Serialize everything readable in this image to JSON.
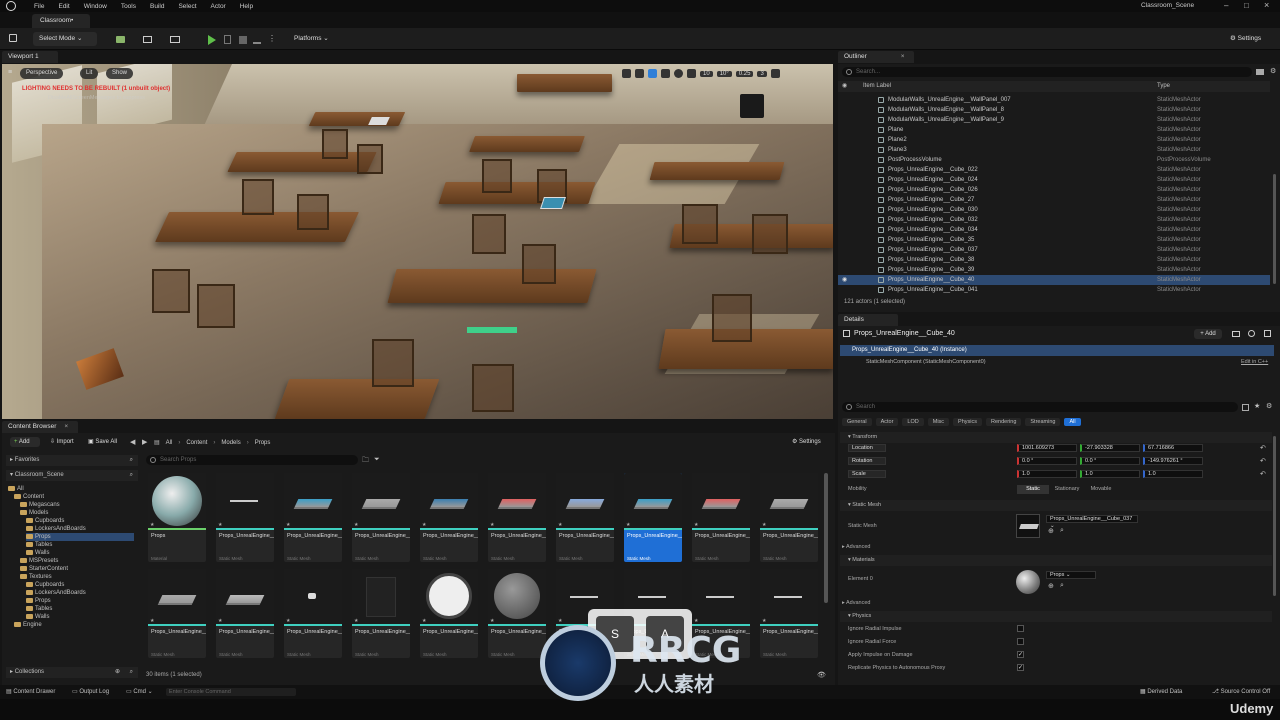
{
  "menu": [
    "File",
    "Edit",
    "Window",
    "Tools",
    "Build",
    "Select",
    "Actor",
    "Help"
  ],
  "project_name": "Classroom_Scene",
  "doc_tab": "Classroom•",
  "toolbar": {
    "select_mode": "Select Mode",
    "platforms": "Platforms",
    "settings": "Settings"
  },
  "viewport": {
    "tab": "Viewport 1",
    "perspective": "Perspective",
    "lit": "Lit",
    "show": "Show",
    "warning": "LIGHTING NEEDS TO BE REBUILT (1 unbuilt object)",
    "subwarning": "DisableAllScreenMessages to suppress",
    "grid": "10",
    "angle": "10°",
    "scale": "0.25",
    "camera": "3"
  },
  "outliner": {
    "tab": "Outliner",
    "search_placeholder": "Search...",
    "col_label": "Item Label",
    "col_type": "Type",
    "rows": [
      {
        "name": "ModularWalls_UnrealEngine__WallPanel_007",
        "type": "StaticMeshActor"
      },
      {
        "name": "ModularWalls_UnrealEngine__WallPanel_8",
        "type": "StaticMeshActor"
      },
      {
        "name": "ModularWalls_UnrealEngine__WallPanel_9",
        "type": "StaticMeshActor"
      },
      {
        "name": "Plane",
        "type": "StaticMeshActor"
      },
      {
        "name": "Plane2",
        "type": "StaticMeshActor"
      },
      {
        "name": "Plane3",
        "type": "StaticMeshActor"
      },
      {
        "name": "PostProcessVolume",
        "type": "PostProcessVolume"
      },
      {
        "name": "Props_UnrealEngine__Cube_022",
        "type": "StaticMeshActor"
      },
      {
        "name": "Props_UnrealEngine__Cube_024",
        "type": "StaticMeshActor"
      },
      {
        "name": "Props_UnrealEngine__Cube_026",
        "type": "StaticMeshActor"
      },
      {
        "name": "Props_UnrealEngine__Cube_27",
        "type": "StaticMeshActor"
      },
      {
        "name": "Props_UnrealEngine__Cube_030",
        "type": "StaticMeshActor"
      },
      {
        "name": "Props_UnrealEngine__Cube_032",
        "type": "StaticMeshActor"
      },
      {
        "name": "Props_UnrealEngine__Cube_034",
        "type": "StaticMeshActor"
      },
      {
        "name": "Props_UnrealEngine__Cube_35",
        "type": "StaticMeshActor"
      },
      {
        "name": "Props_UnrealEngine__Cube_037",
        "type": "StaticMeshActor"
      },
      {
        "name": "Props_UnrealEngine__Cube_38",
        "type": "StaticMeshActor"
      },
      {
        "name": "Props_UnrealEngine__Cube_39",
        "type": "StaticMeshActor"
      },
      {
        "name": "Props_UnrealEngine__Cube_40",
        "type": "StaticMeshActor",
        "selected": true
      },
      {
        "name": "Props_UnrealEngine__Cube_041",
        "type": "StaticMeshActor"
      }
    ],
    "status": "121 actors (1 selected)"
  },
  "details": {
    "tab": "Details",
    "object_name": "Props_UnrealEngine__Cube_40",
    "add": "+ Add",
    "instance": "Props_UnrealEngine__Cube_40 (Instance)",
    "component": "StaticMeshComponent (StaticMeshComponent0)",
    "edit_cpp": "Edit in C++",
    "search_placeholder": "Search",
    "filters": [
      "General",
      "Actor",
      "LOD",
      "Misc",
      "Physics",
      "Rendering",
      "Streaming",
      "All"
    ],
    "transform": "Transform",
    "location_label": "Location",
    "location": [
      "1001.609273",
      "-27.903328",
      "67.716866"
    ],
    "rotation_label": "Rotation",
    "rotation": [
      "0.0 °",
      "0.0 °",
      "-149.976261 °"
    ],
    "scale_label": "Scale",
    "scale": [
      "1.0",
      "1.0",
      "1.0"
    ],
    "mobility_label": "Mobility",
    "mobility": [
      "Static",
      "Stationary",
      "Movable"
    ],
    "static_mesh_section": "Static Mesh",
    "static_mesh_label": "Static Mesh",
    "static_mesh_value": "Props_UnrealEngine__Cube_037",
    "advanced": "Advanced",
    "materials": "Materials",
    "element0": "Element 0",
    "element0_value": "Props",
    "advanced2": "Advanced",
    "physics": "Physics",
    "phys_rows": [
      "Ignore Radial Impulse",
      "Ignore Radial Force",
      "Apply Impulse on Damage",
      "Replicate Physics to Autonomous Proxy"
    ],
    "phys_checked": [
      false,
      false,
      true,
      true
    ]
  },
  "content_browser": {
    "tab": "Content Browser",
    "add": "Add",
    "import": "Import",
    "save_all": "Save All",
    "path": [
      "All",
      "Content",
      "Models",
      "Props"
    ],
    "settings": "Settings",
    "search_placeholder": "Search Props",
    "favorites": "Favorites",
    "project": "Classroom_Scene",
    "tree": [
      {
        "label": "All",
        "indent": 0
      },
      {
        "label": "Content",
        "indent": 1
      },
      {
        "label": "Megascans",
        "indent": 2
      },
      {
        "label": "Models",
        "indent": 2
      },
      {
        "label": "Cupboards",
        "indent": 3
      },
      {
        "label": "LockersAndBoards",
        "indent": 3
      },
      {
        "label": "Props",
        "indent": 3,
        "selected": true
      },
      {
        "label": "Tables",
        "indent": 3
      },
      {
        "label": "Walls",
        "indent": 3
      },
      {
        "label": "MSPresets",
        "indent": 2
      },
      {
        "label": "StarterContent",
        "indent": 2
      },
      {
        "label": "Textures",
        "indent": 2
      },
      {
        "label": "Cupboards",
        "indent": 3
      },
      {
        "label": "LockersAndBoards",
        "indent": 3
      },
      {
        "label": "Props",
        "indent": 3
      },
      {
        "label": "Tables",
        "indent": 3
      },
      {
        "label": "Walls",
        "indent": 3
      },
      {
        "label": "Engine",
        "indent": 1
      }
    ],
    "collections": "Collections",
    "items_row1": [
      {
        "name": "Props",
        "type": "Material"
      },
      {
        "name": "Props_UnrealEngine__Cube_022",
        "type": "Static Mesh"
      },
      {
        "name": "Props_UnrealEngine__Cube_024",
        "type": "Static Mesh"
      },
      {
        "name": "Props_UnrealEngine__Cube_026",
        "type": "Static Mesh"
      },
      {
        "name": "Props_UnrealEngine__Cube_030",
        "type": "Static Mesh"
      },
      {
        "name": "Props_UnrealEngine__Cube_032",
        "type": "Static Mesh"
      },
      {
        "name": "Props_UnrealEngine__Cube_034",
        "type": "Static Mesh"
      },
      {
        "name": "Props_UnrealEngine__Cube_037",
        "type": "Static Mesh",
        "selected": true
      },
      {
        "name": "Props_UnrealEngine__Cube_041",
        "type": "Static Mesh"
      },
      {
        "name": "Props_UnrealEngine__Cube_042",
        "type": "Static Mesh"
      }
    ],
    "items_row2": [
      {
        "name": "Props_UnrealEngine__Cube_045",
        "type": "Static Mesh"
      },
      {
        "name": "Props_UnrealEngine__Cube_047",
        "type": "Static Mesh"
      },
      {
        "name": "Props_UnrealEngine__Cube_049",
        "type": "Static Mesh"
      },
      {
        "name": "Props_UnrealEngine__Cylinder_001",
        "type": "Static Mesh"
      },
      {
        "name": "Props_UnrealEngine__Cylinder_002",
        "type": "Static Mesh"
      },
      {
        "name": "Props_UnrealEngine__Cylinder_003",
        "type": "Static Mesh"
      },
      {
        "name": "Props_UnrealEngine__Cylinder_004",
        "type": "Static Mesh"
      },
      {
        "name": "Props_UnrealEngine__Cylinder_005",
        "type": "Static Mesh"
      },
      {
        "name": "Props_UnrealEngine__Cylinder_006",
        "type": "Static Mesh"
      },
      {
        "name": "Props_UnrealEngine__Cylinder_008",
        "type": "Static Mesh"
      }
    ],
    "item_count": "30 items (1 selected)"
  },
  "statusbar": {
    "content_drawer": "Content Drawer",
    "output_log": "Output Log",
    "cmd": "Cmd",
    "console_placeholder": "Enter Console Command",
    "derived_data": "Derived Data",
    "source_control": "Source Control Off"
  },
  "overlay": {
    "key_s": "S",
    "key_a": "A",
    "watermark": "RRCG",
    "watermark_sub": "人人素材",
    "brand": "Udemy"
  }
}
